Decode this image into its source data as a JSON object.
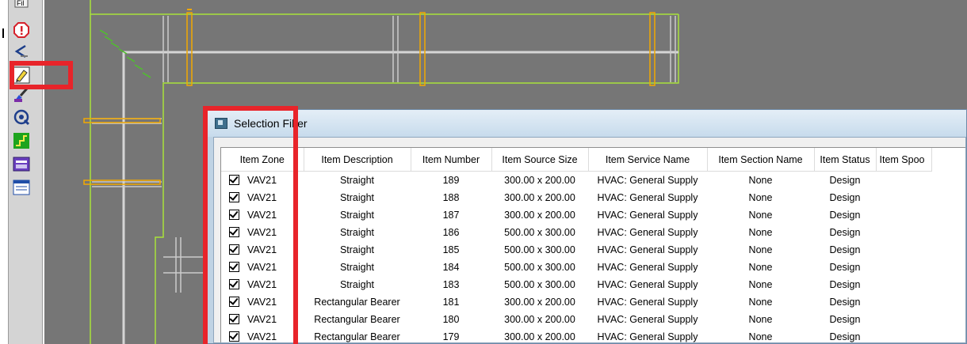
{
  "toolbar": {
    "icons": [
      "file-icon",
      "error-alert-icon",
      "arrow-left-icon",
      "pencil-edit-icon",
      "paint-brush-icon",
      "target-rotate-icon",
      "step-green-icon",
      "window-panel-icon",
      "window-list-icon"
    ],
    "partial_label": "Fil"
  },
  "dialog": {
    "title": "Selection Filter"
  },
  "table": {
    "headers": [
      "Item Zone",
      "Item Description",
      "Item Number",
      "Item Source Size",
      "Item Service Name",
      "Item Section Name",
      "Item Status",
      "Item Spoo"
    ],
    "rows": [
      {
        "zone": "VAV21",
        "description": "Straight",
        "number": "189",
        "size": "300.00 x 200.00",
        "service": "HVAC: General Supply",
        "section": "None",
        "status": "Design"
      },
      {
        "zone": "VAV21",
        "description": "Straight",
        "number": "188",
        "size": "300.00 x 200.00",
        "service": "HVAC: General Supply",
        "section": "None",
        "status": "Design"
      },
      {
        "zone": "VAV21",
        "description": "Straight",
        "number": "187",
        "size": "300.00 x 200.00",
        "service": "HVAC: General Supply",
        "section": "None",
        "status": "Design"
      },
      {
        "zone": "VAV21",
        "description": "Straight",
        "number": "186",
        "size": "500.00 x 300.00",
        "service": "HVAC: General Supply",
        "section": "None",
        "status": "Design"
      },
      {
        "zone": "VAV21",
        "description": "Straight",
        "number": "185",
        "size": "500.00 x 300.00",
        "service": "HVAC: General Supply",
        "section": "None",
        "status": "Design"
      },
      {
        "zone": "VAV21",
        "description": "Straight",
        "number": "184",
        "size": "500.00 x 300.00",
        "service": "HVAC: General Supply",
        "section": "None",
        "status": "Design"
      },
      {
        "zone": "VAV21",
        "description": "Straight",
        "number": "183",
        "size": "500.00 x 300.00",
        "service": "HVAC: General Supply",
        "section": "None",
        "status": "Design"
      },
      {
        "zone": "VAV21",
        "description": "Rectangular Bearer",
        "number": "181",
        "size": "300.00 x 200.00",
        "service": "HVAC: General Supply",
        "section": "None",
        "status": "Design"
      },
      {
        "zone": "VAV21",
        "description": "Rectangular Bearer",
        "number": "180",
        "size": "300.00 x 200.00",
        "service": "HVAC: General Supply",
        "section": "None",
        "status": "Design"
      },
      {
        "zone": "VAV21",
        "description": "Rectangular Bearer",
        "number": "179",
        "size": "300.00 x 200.00",
        "service": "HVAC: General Supply",
        "section": "None",
        "status": "Design"
      }
    ]
  },
  "colors": {
    "highlight": "#e8242a",
    "cad_background": "#767676",
    "duct_outline": "#9acd32",
    "hanger": "#f2a900"
  }
}
